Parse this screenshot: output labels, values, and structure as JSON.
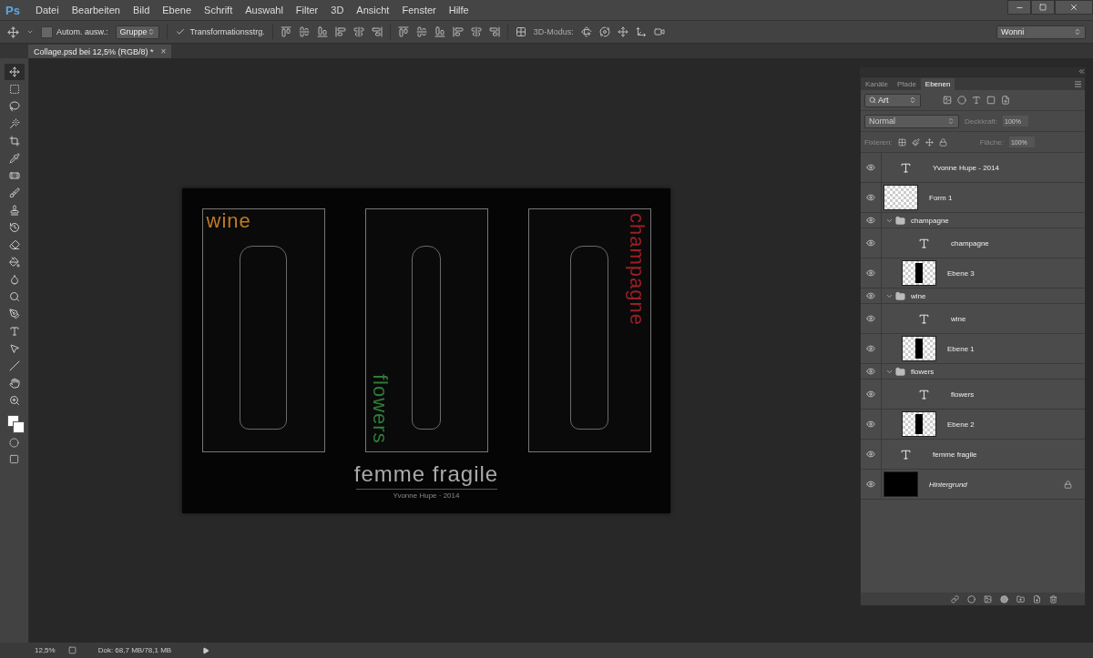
{
  "app": {
    "logo": "Ps"
  },
  "menu": [
    "Datei",
    "Bearbeiten",
    "Bild",
    "Ebene",
    "Schrift",
    "Auswahl",
    "Filter",
    "3D",
    "Ansicht",
    "Fenster",
    "Hilfe"
  ],
  "options_bar": {
    "auto_select": {
      "label": "Autom. ausw.:",
      "checked": false
    },
    "auto_select_target": "Gruppe",
    "transform_controls": {
      "label": "Transformationsstrg.",
      "checked": true
    },
    "mode_3d_label": "3D-Modus:",
    "workspace": "Wonni"
  },
  "document_tab": {
    "title": "Collage.psd bei 12,5% (RGB/8) *",
    "close": "×"
  },
  "tools": [
    {
      "kind": "move",
      "selected": true
    },
    {
      "kind": "marquee",
      "selected": false
    },
    {
      "kind": "lasso",
      "selected": false
    },
    {
      "kind": "wand",
      "selected": false
    },
    {
      "kind": "crop",
      "selected": false
    },
    {
      "kind": "eyedropper",
      "selected": false
    },
    {
      "kind": "heal",
      "selected": false
    },
    {
      "kind": "brush",
      "selected": false
    },
    {
      "kind": "stamp",
      "selected": false
    },
    {
      "kind": "history",
      "selected": false
    },
    {
      "kind": "eraser",
      "selected": false
    },
    {
      "kind": "bucket",
      "selected": false
    },
    {
      "kind": "blur",
      "selected": false
    },
    {
      "kind": "dodge",
      "selected": false
    },
    {
      "kind": "pen",
      "selected": false
    },
    {
      "kind": "type",
      "selected": false
    },
    {
      "kind": "path",
      "selected": false
    },
    {
      "kind": "line",
      "selected": false
    },
    {
      "kind": "hand",
      "selected": false
    },
    {
      "kind": "zoom",
      "selected": false
    }
  ],
  "document": {
    "panels": [
      {
        "label": "wine",
        "color": "#c07a22",
        "kind": "horizontal"
      },
      {
        "label": "flowers",
        "color": "#2f7d37",
        "kind": "vertical"
      },
      {
        "label": "champagne",
        "color": "#9a1f28",
        "kind": "side"
      }
    ],
    "title": "femme fragile",
    "subtitle": "Yvonne Hupe · 2014"
  },
  "layers_panel": {
    "tabs": [
      {
        "label": "Kanäle",
        "selected": false
      },
      {
        "label": "Pfade",
        "selected": false
      },
      {
        "label": "Ebenen",
        "selected": true
      }
    ],
    "filter": "Art",
    "blend_mode": "Normal",
    "opacity_label": "Deckkraft:",
    "opacity": "100%",
    "lock_label": "Fixieren:",
    "fill_label": "Fläche:",
    "fill": "100%",
    "layers": [
      {
        "kind": "text",
        "name": "Yvonne Hupe - 2014",
        "visible": true
      },
      {
        "kind": "shape",
        "name": "Form 1",
        "visible": true
      },
      {
        "kind": "group",
        "name": "champagne",
        "visible": true,
        "expanded": true,
        "children": [
          {
            "kind": "text",
            "name": "champagne",
            "visible": true
          },
          {
            "kind": "pixel",
            "name": "Ebene 3",
            "visible": true
          }
        ]
      },
      {
        "kind": "group",
        "name": "wine",
        "visible": true,
        "expanded": true,
        "children": [
          {
            "kind": "text",
            "name": "wine",
            "visible": true
          },
          {
            "kind": "pixel",
            "name": "Ebene 1",
            "visible": true
          }
        ]
      },
      {
        "kind": "group",
        "name": "flowers",
        "visible": true,
        "expanded": true,
        "children": [
          {
            "kind": "text",
            "name": "flowers",
            "visible": true
          },
          {
            "kind": "pixel",
            "name": "Ebene 2",
            "visible": true
          }
        ]
      },
      {
        "kind": "text",
        "name": "femme fragile",
        "visible": true
      },
      {
        "kind": "background",
        "name": "Hintergrund",
        "visible": true,
        "locked": true
      }
    ]
  },
  "status_bar": {
    "zoom": "12,5%",
    "doc_size": "Dok: 68,7 MB/78,1 MB"
  }
}
